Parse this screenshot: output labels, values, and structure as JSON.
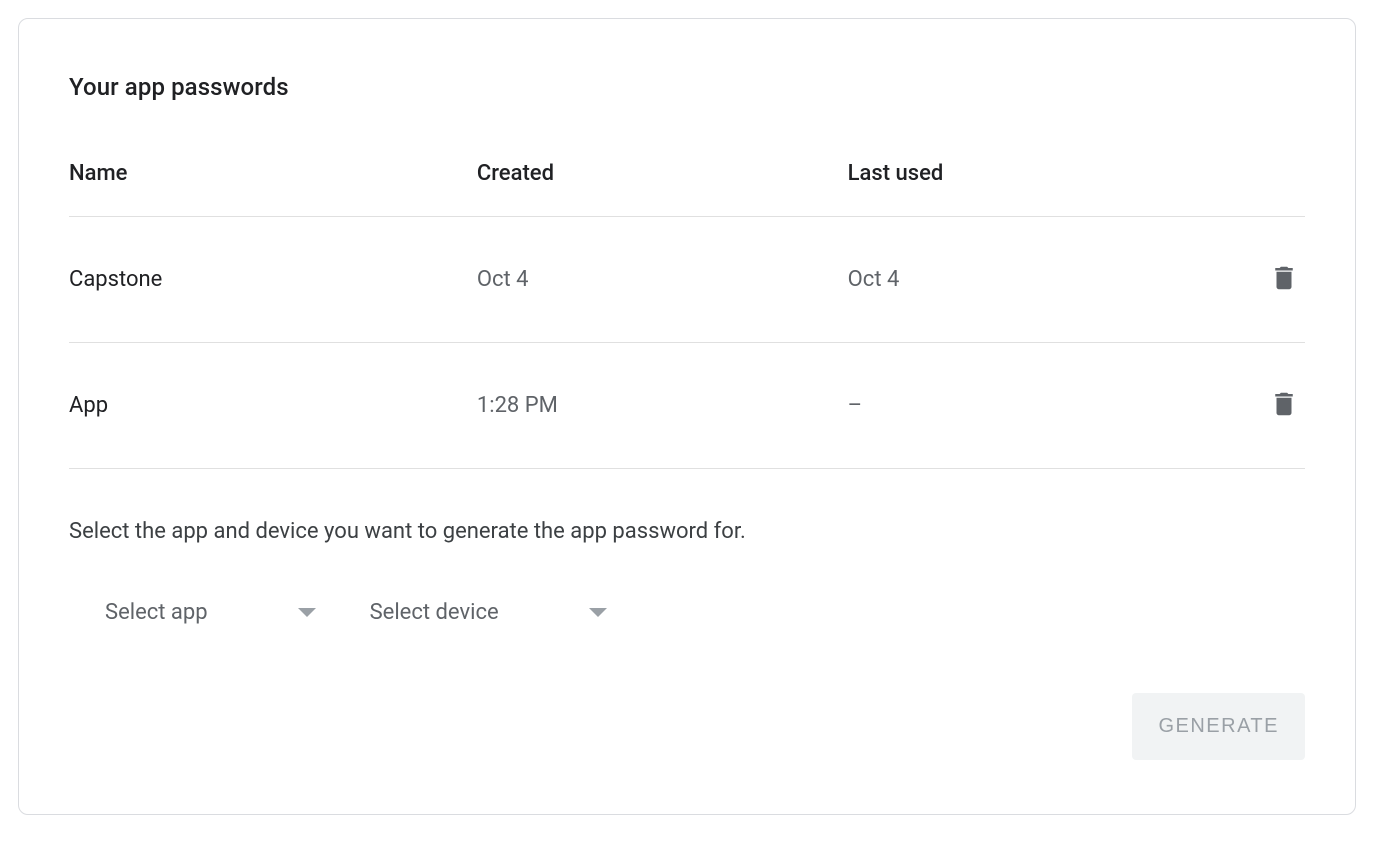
{
  "title": "Your app passwords",
  "columns": {
    "name": "Name",
    "created": "Created",
    "lastused": "Last used"
  },
  "rows": [
    {
      "name": "Capstone",
      "created": "Oct 4",
      "lastused": "Oct 4"
    },
    {
      "name": "App",
      "created": "1:28 PM",
      "lastused": "–"
    }
  ],
  "instruction": "Select the app and device you want to generate the app password for.",
  "selectors": {
    "app": "Select app",
    "device": "Select device"
  },
  "generate": "GENERATE"
}
